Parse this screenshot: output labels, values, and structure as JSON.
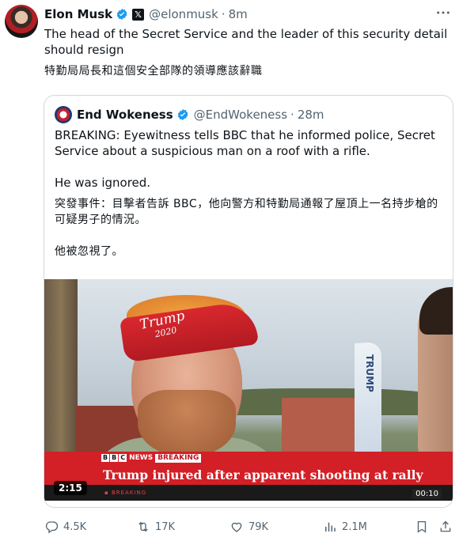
{
  "post": {
    "author_name": "Elon Musk",
    "handle": "@elonmusk",
    "separator": "·",
    "time": "8m",
    "text_en": "The head of the Secret Service and the leader of this security detail should resign",
    "text_zh": "特勤局局長和這個安全部隊的領導應該辭職"
  },
  "quote": {
    "author_name": "End Wokeness",
    "handle": "@EndWokeness",
    "separator": "·",
    "time": "28m",
    "para1": "BREAKING: Eyewitness tells BBC that he informed police, Secret Service about a suspicious man on a roof with a rifle.",
    "para2": "He was ignored.",
    "para3_zh": "突發事件：目擊者告訴 BBC，他向警方和特勤局通報了屋頂上一名持步槍的可疑男子的情況。",
    "para4_zh": "他被忽視了。",
    "media": {
      "bbc_letters": [
        "B",
        "B",
        "C"
      ],
      "news_tag": "NEWS",
      "breaking_tag": "BREAKING",
      "headline": "Trump injured after apparent shooting at rally",
      "strip_text": "▪ BREAKING",
      "duration": "2:15",
      "clock": "00:10",
      "visor_text": "Trump",
      "visor_year": "2020",
      "flag_text": "TRUMP"
    }
  },
  "actions": {
    "replies": "4.5K",
    "reposts": "17K",
    "likes": "79K",
    "views": "2.1M"
  },
  "icons": [
    "verified-badge-icon",
    "x-affiliate-icon",
    "more-icon",
    "reply-icon",
    "repost-icon",
    "like-icon",
    "views-icon",
    "bookmark-icon",
    "share-icon"
  ],
  "colors": {
    "verified": "#1d9bf0",
    "muted": "#536471",
    "bbc_red": "#d31f26",
    "border": "#cfd9de"
  }
}
